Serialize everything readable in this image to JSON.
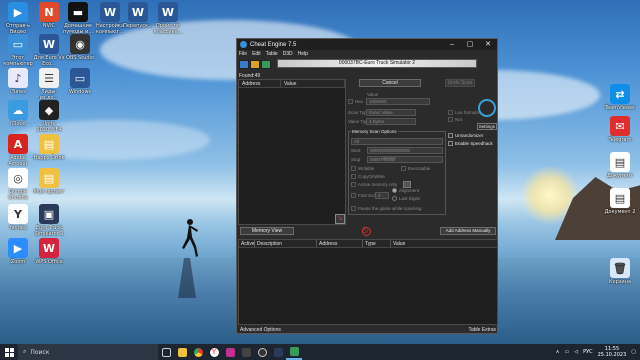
{
  "desktop_icons": [
    {
      "label": "Отправ-ь Видео",
      "color": "#2a8fe0",
      "glyph": "▶"
    },
    {
      "label": "NVIC",
      "color": "#e04a2a",
      "glyph": "N"
    },
    {
      "label": "Домашние пумоды и...",
      "color": "#111111",
      "glyph": "▬"
    },
    {
      "label": "Настройка компьют...",
      "color": "#2b5797",
      "glyph": "W"
    },
    {
      "label": "Перепуск...",
      "color": "#2b5797",
      "glyph": "W"
    },
    {
      "label": "Пройс по классике...",
      "color": "#2b5797",
      "glyph": "W"
    },
    {
      "label": "Этот компьютер",
      "color": "#3b8fd8",
      "glyph": "▭"
    },
    {
      "label": "Для Euro Vs Eco...",
      "color": "#2b5797",
      "glyph": "W"
    },
    {
      "label": "OBS Studio",
      "color": "#333333",
      "glyph": "◉"
    },
    {
      "label": "iTunes",
      "color": "#e8e8ff",
      "glyph": "♪"
    },
    {
      "label": "Лиды- из.до...",
      "color": "#f0f0f0",
      "glyph": "☰"
    },
    {
      "label": "Windows",
      "color": "#2b5797",
      "glyph": "▭"
    },
    {
      "label": "iCloud",
      "color": "#3a9be0",
      "glyph": "☁"
    },
    {
      "label": "Unity 2020.3.F4",
      "color": "#222222",
      "glyph": "◆"
    },
    {
      "label": "Adobe Acrobat",
      "color": "#d8231e",
      "glyph": "A"
    },
    {
      "label": "Happy Drink",
      "color": "#f0c040",
      "glyph": "▤"
    },
    {
      "label": "Google Chrome",
      "color": "#ffffff",
      "glyph": "◎"
    },
    {
      "label": "Мой проект",
      "color": "#f0c040",
      "glyph": "▤"
    },
    {
      "label": "Yandex",
      "color": "#ffffff",
      "glyph": "Y"
    },
    {
      "label": "Euro Truck Simulator 2",
      "color": "#2a3a5a",
      "glyph": "▣"
    },
    {
      "label": "Zoom",
      "color": "#2d8cff",
      "glyph": "▶"
    },
    {
      "label": "WPS Office",
      "color": "#d8233e",
      "glyph": "W"
    },
    {
      "label": "TeamViewer",
      "color": "#0e8ee9",
      "glyph": "⇄"
    },
    {
      "label": "Telegram",
      "color": "#e02e2e",
      "glyph": "✉"
    },
    {
      "label": "Документ",
      "color": "#ffffff",
      "glyph": "▤"
    },
    {
      "label": "Документ 2",
      "color": "#ffffff",
      "glyph": "▤"
    },
    {
      "label": "Корзина",
      "color": "#d8e8f8",
      "glyph": "🗑"
    }
  ],
  "cheat_engine": {
    "title": "Cheat Engine 7.5",
    "menu": [
      "File",
      "Edit",
      "Table",
      "D3D",
      "Help"
    ],
    "process": "000037BC-Euro Truck Simulator 2",
    "found": "Found:49",
    "result_columns": [
      "Address",
      "Value"
    ],
    "cancel_label": "Cancel",
    "undo_scan_label": "Undo Scan",
    "settings_label": "Settings",
    "value_label": "Value",
    "hex_label": "Hex",
    "value_input": "1000000",
    "scan_type_label": "Scan Type",
    "scan_type_value": "Exact Value",
    "value_type_label": "Value Type",
    "value_type_value": "4 Bytes",
    "lua_formula_label": "Lua formula",
    "not_label": "Not",
    "memory_scan_options_label": "Memory Scan Options",
    "memory_region": "All",
    "start_label": "Start",
    "start_value": "0000000000000000",
    "stop_label": "Stop",
    "stop_value": "00007fffffffffff",
    "writable_label": "Writable",
    "executable_label": "Executable",
    "copyonwrite_label": "CopyOnWrite",
    "active_memory_label": "Active memory only",
    "fast_scan_label": "Fast Scan",
    "fast_scan_value": "4",
    "alignment_label": "Alignment",
    "last_digits_label": "Last Digits",
    "pause_label": "Pause the game while scanning",
    "unrandomizer_label": "Unrandomizer",
    "speedhack_label": "Enable Speedhack",
    "memory_view_label": "Memory View",
    "add_address_label": "Add Address Manually",
    "address_columns": [
      "Active",
      "Description",
      "Address",
      "Type",
      "Value"
    ],
    "advanced_options_label": "Advanced Options",
    "table_extras_label": "Table Extras"
  },
  "taskbar": {
    "search_placeholder": "Поиск",
    "tray_temp": "∧",
    "tray_lang": "РУС",
    "time": "11:55",
    "date": "25.10.2023"
  }
}
